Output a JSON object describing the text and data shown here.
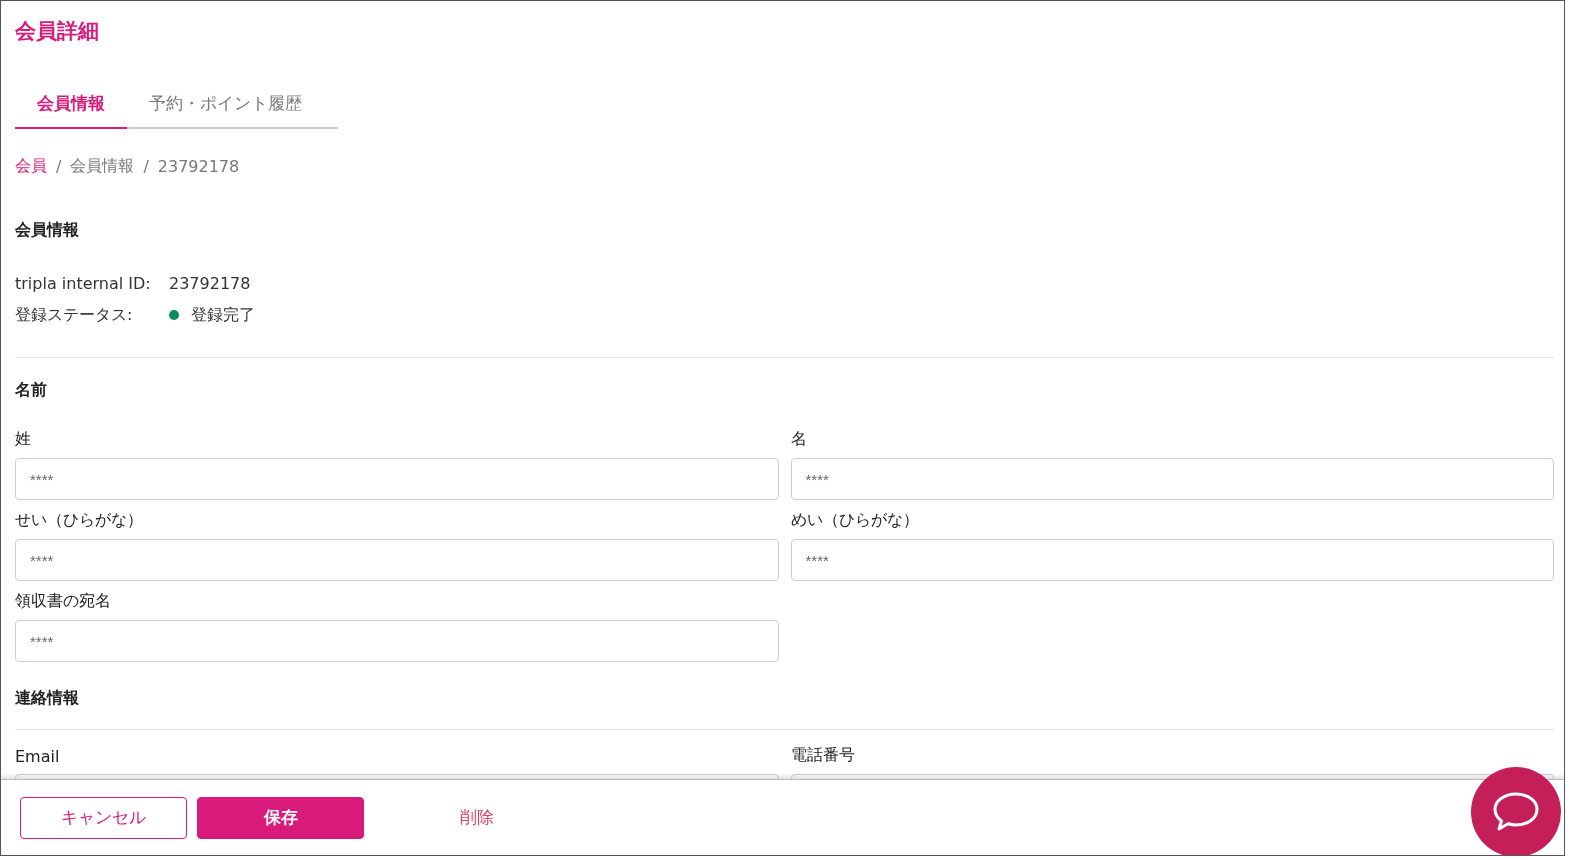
{
  "page_title": "会員詳細",
  "tabs": [
    {
      "label": "会員情報",
      "selected": true
    },
    {
      "label": "予約・ポイント履歴",
      "selected": false
    }
  ],
  "breadcrumb": [
    {
      "label": "会員",
      "link": true
    },
    {
      "label": "会員情報",
      "link": false
    },
    {
      "label": "23792178",
      "link": false
    }
  ],
  "breadcrumb_separators": [
    "/",
    "/"
  ],
  "member_info": {
    "heading": "会員情報",
    "id_label": "tripla internal ID:",
    "id_value": "23792178",
    "status": {
      "label": "登録ステータス:",
      "value": "登録完了",
      "color": "#0b8a5f"
    }
  },
  "name_section": {
    "heading": "名前",
    "fields": [
      {
        "label": "姓",
        "placeholder": "****"
      },
      {
        "label": "名",
        "placeholder": "****"
      },
      {
        "label": "せい（ひらがな）",
        "placeholder": "****"
      },
      {
        "label": "めい（ひらがな）",
        "placeholder": "****"
      },
      {
        "label": "領収書の宛名",
        "placeholder": "****"
      }
    ]
  },
  "contact_section": {
    "heading": "連絡情報",
    "fields": [
      {
        "label": "Email"
      },
      {
        "label": "電話番号"
      }
    ]
  },
  "footer": {
    "cancel": "キャンセル",
    "save": "保存",
    "delete": "削除"
  }
}
